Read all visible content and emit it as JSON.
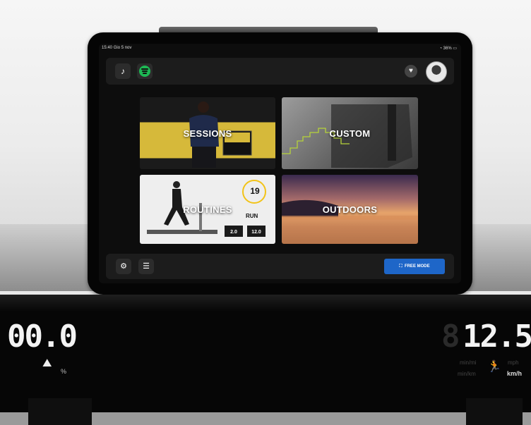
{
  "status": {
    "time": "15:40",
    "date": "Gio 5 nov",
    "battery": "36%"
  },
  "topbar": {
    "music_icon": "music-note-icon",
    "spotify_icon": "spotify-icon",
    "heart_icon": "heart-icon"
  },
  "tiles": [
    {
      "label": "SESSIONS"
    },
    {
      "label": "CUSTOM"
    },
    {
      "label": "ROUTINES",
      "timer_value": "19",
      "mode": "RUN",
      "stat1": "2.0",
      "stat2": "12.0"
    },
    {
      "label": "OUTDOORS"
    }
  ],
  "bottombar": {
    "settings_icon": "gear-icon",
    "list_icon": "list-icon",
    "free_mode_label": "FREE MODE"
  },
  "console": {
    "incline_value": "00.0",
    "incline_unit": "%",
    "speed_value": "12.5",
    "units": {
      "pace_mi": "min/mi",
      "pace_km": "min/km",
      "mph": "mph",
      "kmh": "km/h"
    }
  },
  "colors": {
    "accent": "#1e66c8",
    "spotify": "#1db954"
  }
}
